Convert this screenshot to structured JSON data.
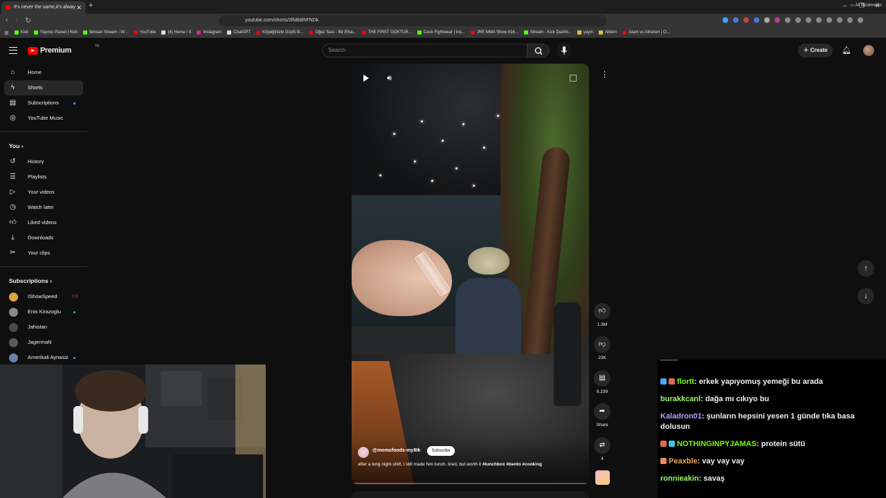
{
  "browser": {
    "tab_title": "It's never the same,it's alway",
    "url": "youtube.com/shorts/2lh8kBhFNDk",
    "bookmarks": [
      {
        "label": "Kick",
        "icon": "kick-icon"
      },
      {
        "label": "Yayıncı Paneli | Kick",
        "icon": "kick-icon"
      },
      {
        "label": "İkinsan Stream - W...",
        "icon": "kick-icon"
      },
      {
        "label": "YouTube",
        "icon": "youtube-icon"
      },
      {
        "label": "(4) Home / X",
        "icon": "x-icon"
      },
      {
        "label": "Instagram",
        "icon": "instagram-icon"
      },
      {
        "label": "ChatGPT",
        "icon": "chatgpt-icon"
      },
      {
        "label": "Köpeğinizle Güçlü B...",
        "icon": "youtube-icon"
      },
      {
        "label": "Oğuz Sası - Bir Efsa...",
        "icon": "youtube-icon"
      },
      {
        "label": "THE FIRST GOKTUR...",
        "icon": "youtube-icon"
      },
      {
        "label": "Cave Fightwear | Ins...",
        "icon": "leaf-icon"
      },
      {
        "label": "JRE MMA Show #16...",
        "icon": "youtube-icon"
      },
      {
        "label": "Stream - Kick Dashb...",
        "icon": "kick-icon"
      },
      {
        "label": "yayın",
        "icon": "folder-icon"
      },
      {
        "label": "Albüm",
        "icon": "folder-icon"
      },
      {
        "label": "İslam vs Atheism | O...",
        "icon": "youtube-icon"
      }
    ],
    "all_bookmarks": "All Bookmarks"
  },
  "header": {
    "logo_text": "Premium",
    "logo_sup": "TR",
    "search_placeholder": "Search",
    "create_label": "Create"
  },
  "sidebar": {
    "main": [
      {
        "label": "Home",
        "icon": "home-icon"
      },
      {
        "label": "Shorts",
        "icon": "shorts-icon",
        "active": true
      },
      {
        "label": "Subscriptions",
        "icon": "subscriptions-icon"
      },
      {
        "label": "YouTube Music",
        "icon": "music-icon"
      }
    ],
    "you_title": "You",
    "you": [
      {
        "label": "History",
        "icon": "history-icon"
      },
      {
        "label": "Playlists",
        "icon": "playlists-icon"
      },
      {
        "label": "Your videos",
        "icon": "your-videos-icon"
      },
      {
        "label": "Watch later",
        "icon": "watch-later-icon"
      },
      {
        "label": "Liked videos",
        "icon": "like-icon"
      },
      {
        "label": "Downloads",
        "icon": "download-icon"
      },
      {
        "label": "Your clips",
        "icon": "scissors-icon"
      }
    ],
    "subs_title": "Subscriptions",
    "subs": [
      {
        "label": "IShowSpeed",
        "color": "#d9a441"
      },
      {
        "label": "Enis Kirazoglu",
        "color": "#8a8a8a"
      },
      {
        "label": "Jahistan",
        "color": "#4a4a4a"
      },
      {
        "label": "JagermaN",
        "color": "#5a5a5a"
      },
      {
        "label": "Amerikali Aynasiz",
        "color": "#6b7fa8"
      }
    ]
  },
  "short": {
    "channel": "@momofoods-my8tk",
    "subscribe_label": "Subscribe",
    "caption": "after a long night shift, I still made him lunch. tired, but worth it",
    "hashtags": [
      "#lunchbox",
      "#bento",
      "#cooking"
    ],
    "likes": "1.3M",
    "dislikes": "23K",
    "comments": "8,239",
    "share": "Share",
    "remix": "4"
  },
  "chat": {
    "messages": [
      {
        "user": "flortt",
        "text": "erkek yapıyomuş yemeği bu arada",
        "color": "#7cfc00"
      },
      {
        "user": "burakkcanl",
        "text": "dağa mı cıkıyo bu",
        "color": "#9bfa6b"
      },
      {
        "user": "Kaladron01",
        "text": "şunların hepsini yesen 1 günde tıka basa dolusun",
        "color": "#b6a4ff"
      },
      {
        "user": "NOTHINGINPYJAMAS",
        "text": "protein sütü",
        "color": "#7cfc00"
      },
      {
        "user": "Peaxble",
        "text": "vay vay vay",
        "color": "#f0a64d"
      },
      {
        "user": "ronnieakin",
        "text": "savaş",
        "color": "#9bfa6b"
      }
    ]
  },
  "colors": {
    "brand": "#ff0000",
    "background": "#0f0f0f",
    "accent_blue": "#3ea6ff",
    "kick_green": "#53fc18"
  }
}
